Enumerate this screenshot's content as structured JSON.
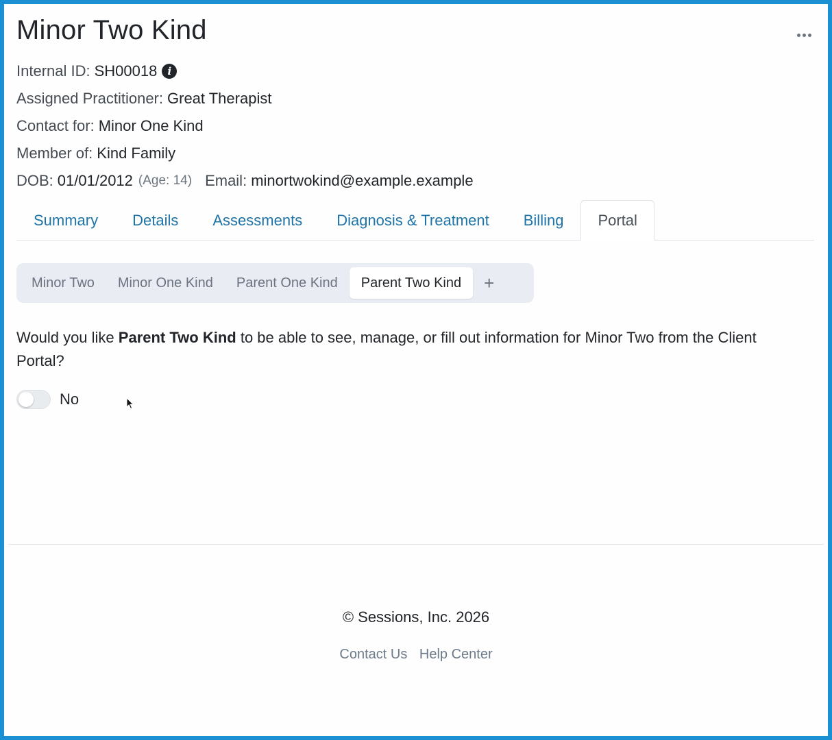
{
  "header": {
    "title": "Minor Two Kind",
    "menu_icon": "more-horizontal-icon"
  },
  "info": {
    "internal_id_label": "Internal ID:",
    "internal_id": "SH00018",
    "practitioner_label": "Assigned Practitioner:",
    "practitioner": "Great Therapist",
    "contact_for_label": "Contact for:",
    "contact_for": "Minor One Kind",
    "member_of_label": "Member of:",
    "member_of": "Kind Family",
    "dob_label": "DOB:",
    "dob": "01/01/2012",
    "age": "(Age: 14)",
    "email_label": "Email:",
    "email": "minortwokind@example.example"
  },
  "tabs": [
    {
      "label": "Summary",
      "active": false
    },
    {
      "label": "Details",
      "active": false
    },
    {
      "label": "Assessments",
      "active": false
    },
    {
      "label": "Diagnosis & Treatment",
      "active": false
    },
    {
      "label": "Billing",
      "active": false
    },
    {
      "label": "Portal",
      "active": true
    }
  ],
  "subtabs": [
    {
      "label": "Minor Two",
      "active": false
    },
    {
      "label": "Minor One Kind",
      "active": false
    },
    {
      "label": "Parent One Kind",
      "active": false
    },
    {
      "label": "Parent Two Kind",
      "active": true
    }
  ],
  "subtabs_add": "+",
  "portal": {
    "question_prefix": "Would you like ",
    "question_name": "Parent Two Kind",
    "question_suffix": " to be able to see, manage, or fill out information for Minor Two from the Client Portal?",
    "toggle_label": "No",
    "toggle_on": false
  },
  "footer": {
    "copyright": "© Sessions, Inc. 2026",
    "links": [
      "Contact Us",
      "Help Center"
    ]
  },
  "colors": {
    "frame": "#1a8fd1",
    "link": "#1e73a8"
  }
}
